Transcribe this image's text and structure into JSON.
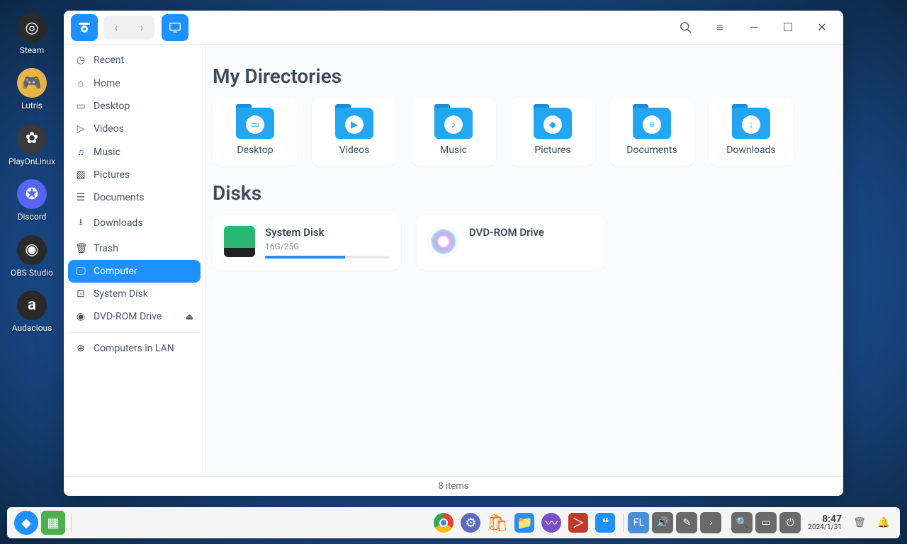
{
  "desktop": {
    "icons": [
      {
        "label": "Steam",
        "bg": "#2a2a2a"
      },
      {
        "label": "Lutris",
        "bg": "#e8b548"
      },
      {
        "label": "PlayOnLinux",
        "bg": "#3a3a3a"
      },
      {
        "label": "Discord",
        "bg": "#5865f2"
      },
      {
        "label": "OBS Studio",
        "bg": "#2a2a2a"
      },
      {
        "label": "Audacious",
        "bg": "#2a2a2a"
      }
    ]
  },
  "window": {
    "toolbar": {
      "back": "‹",
      "forward": "›"
    },
    "sidebar": {
      "items": [
        {
          "icon": "◷",
          "label": "Recent"
        },
        {
          "icon": "⌂",
          "label": "Home"
        },
        {
          "icon": "▭",
          "label": "Desktop"
        },
        {
          "icon": "▷",
          "label": "Videos"
        },
        {
          "icon": "♫",
          "label": "Music"
        },
        {
          "icon": "▨",
          "label": "Pictures"
        },
        {
          "icon": "☰",
          "label": "Documents"
        },
        {
          "icon": "⭳",
          "label": "Downloads"
        },
        {
          "icon": "🗑",
          "label": "Trash"
        },
        {
          "icon": "🖵",
          "label": "Computer",
          "active": true
        },
        {
          "icon": "⊡",
          "label": "System Disk"
        },
        {
          "icon": "◉",
          "label": "DVD-ROM Drive",
          "eject": true
        },
        {
          "divider": true
        },
        {
          "icon": "⊕",
          "label": "Computers in LAN"
        }
      ]
    },
    "content": {
      "section1_title": "My Directories",
      "directories": [
        {
          "label": "Desktop",
          "glyph": "▭"
        },
        {
          "label": "Videos",
          "glyph": "▶"
        },
        {
          "label": "Music",
          "glyph": "♪"
        },
        {
          "label": "Pictures",
          "glyph": "◆"
        },
        {
          "label": "Documents",
          "glyph": "≡"
        },
        {
          "label": "Downloads",
          "glyph": "↓"
        }
      ],
      "section2_title": "Disks",
      "disks": [
        {
          "name": "System Disk",
          "usage": "16G/25G",
          "percent": 64,
          "type": "sys"
        },
        {
          "name": "DVD-ROM Drive",
          "usage": "",
          "type": "dvd"
        }
      ]
    },
    "status": "8 items"
  },
  "taskbar": {
    "clock": {
      "time": "8:47",
      "date": "2024/1/31"
    }
  }
}
